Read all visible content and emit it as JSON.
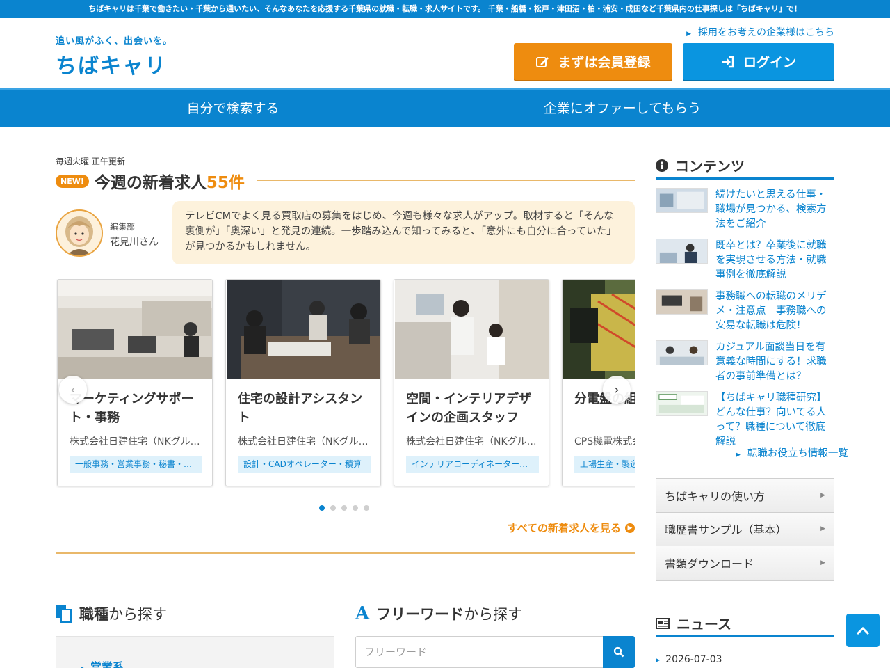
{
  "topbar": {
    "text": "ちばキャリは千葉で働きたい・千葉から通いたい、そんなあなたを応援する千葉県の就職・転職・求人サイトです。 千葉・船橋・松戸・津田沼・柏・浦安・成田など千葉県内の仕事探しは「ちばキャリ」で！"
  },
  "header": {
    "logo_tagline": "追い風がふく、出会いを。",
    "logo_text": "ちばキャリ",
    "employer_link": "採用をお考えの企業様はこちら",
    "register_button": "まずは会員登録",
    "login_button": "ログイン"
  },
  "nav": {
    "items": [
      "自分で検索する",
      "企業にオファーしてもらう"
    ]
  },
  "new_jobs": {
    "update_note": "毎週火曜 正午更新",
    "badge": "NEW!",
    "title": "今週の新着求人",
    "count": "55件",
    "editor_dept": "編集部",
    "editor_name": "花見川さん",
    "editor_comment": "テレビCMでよく見る買取店の募集をはじめ、今週も様々な求人がアップ。取材すると「そんな裏側が」「奥深い」と発見の連続。一歩踏み込んで知ってみると、「意外にも自分に合っていた」が見つかるかもしれません。",
    "cards": [
      {
        "title": "マーケティングサポート・事務",
        "company": "株式会社日建住宅（NKグループ）",
        "tag": "一般事務・営業事務・秘書・受付"
      },
      {
        "title": "住宅の設計アシスタント",
        "company": "株式会社日建住宅（NKグループ）",
        "tag": "設計・CADオペレーター・積算"
      },
      {
        "title": "空間・インテリアデザインの企画スタッフ",
        "company": "株式会社日建住宅（NKグループ）",
        "tag": "インテリアコーディネーター・デザイナー"
      },
      {
        "title": "分電盤の組立",
        "company": "CPS機電株式会社",
        "tag": "工場生産・製造"
      }
    ],
    "see_all": "すべての新着求人を見る"
  },
  "search": {
    "category_head_bold": "職種",
    "category_head_rest": "から探す",
    "category_first": "営業系",
    "freeword_head_bold": "フリーワード",
    "freeword_head_rest": "から探す",
    "freeword_placeholder": "フリーワード"
  },
  "sidebar": {
    "contents_head": "コンテンツ",
    "articles": [
      "続けたいと思える仕事・職場が見つかる、検索方法をご紹介",
      "既卒とは？卒業後に就職を実現させる方法・就職事例を徹底解説",
      "事務職への転職のメリデメ・注意点　事務職への安易な転職は危険！",
      "カジュアル面談当日を有意義な時間にする！求職者の事前準備とは？",
      "【ちばキャリ職種研究】どんな仕事？向いてる人って？職種について徹底解説"
    ],
    "articles_more": "転職お役立ち情報一覧",
    "links": [
      "ちばキャリの使い方",
      "職歴書サンプル（基本）",
      "書類ダウンロード"
    ],
    "news_head": "ニュース",
    "news_date": "2026-07-03"
  },
  "colors": {
    "brand_blue": "#0a84cf",
    "accent_orange": "#ee8c0f"
  },
  "icons": {
    "register": "edit-icon",
    "login": "sign-in-icon",
    "back_to_top": "chevron-up-icon"
  }
}
